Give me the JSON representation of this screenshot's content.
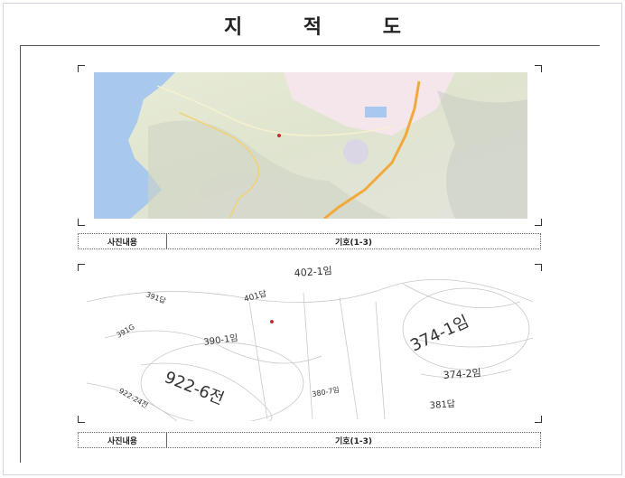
{
  "document": {
    "title": "지 적 도"
  },
  "section1": {
    "caption_label": "사진내용",
    "caption_value": "기호(1-3)"
  },
  "section2": {
    "caption_label": "사진내용",
    "caption_value": "기호(1-3)",
    "parcels": {
      "p922_6": "922-6전",
      "p374_1": "374-1임",
      "p374_2": "374-2임",
      "p390_1": "390-1임",
      "p402_1": "402-1임",
      "p401": "401답",
      "p391": "391답",
      "p381": "381답",
      "p380_7": "380-7임",
      "p922_24": "922-24전",
      "p391g": "391G"
    }
  }
}
